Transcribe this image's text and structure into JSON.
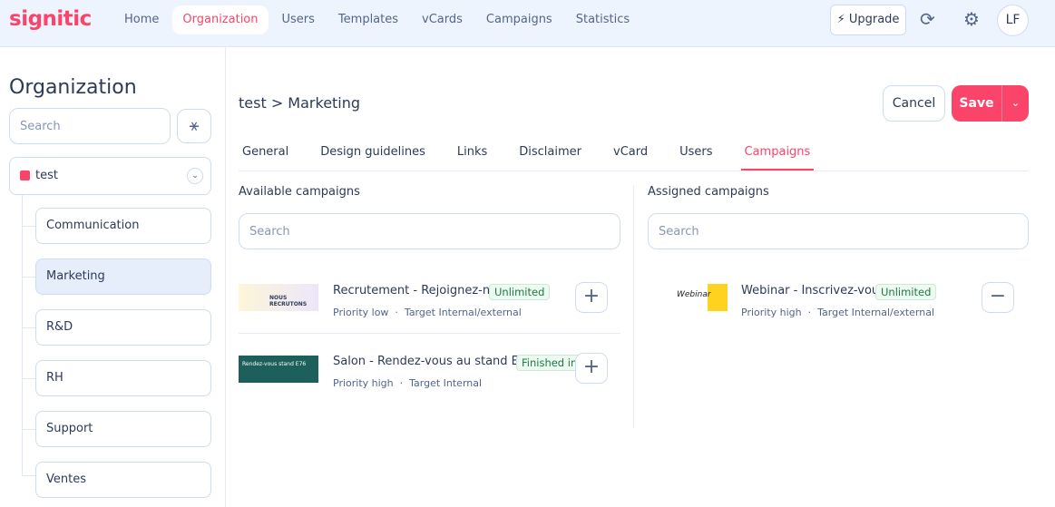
{
  "brand": {
    "logo": "signitic",
    "accent": "#fb4469"
  },
  "nav": {
    "items": [
      "Home",
      "Organization",
      "Users",
      "Templates",
      "vCards",
      "Campaigns",
      "Statistics"
    ],
    "active": 1,
    "upgrade": "Upgrade",
    "avatar": "LF"
  },
  "sidebar": {
    "title": "Organization",
    "search_placeholder": "Search",
    "root": "test",
    "children": [
      "Communication",
      "Marketing",
      "R&D",
      "RH",
      "Support",
      "Ventes"
    ],
    "selected": 1
  },
  "main": {
    "breadcrumb": "test > Marketing",
    "cancel": "Cancel",
    "save": "Save",
    "tabs": [
      "General",
      "Design guidelines",
      "Links",
      "Disclaimer",
      "vCard",
      "Users",
      "Campaigns"
    ],
    "active_tab": 6,
    "available": {
      "title": "Available campaigns",
      "search_placeholder": "Search",
      "items": [
        {
          "title": "Recrutement - Rejoignez-n...",
          "badge": "Unlimited",
          "priority": "Priority low",
          "target": "Target Internal/external",
          "thumb_text": "NOUS RECRUTONS"
        },
        {
          "title": "Salon - Rendez-vous au stand E76",
          "badge": "Finished in 3...",
          "priority": "Priority high",
          "target": "Target Internal",
          "thumb_text": "Rendez-vous stand E76"
        }
      ]
    },
    "assigned": {
      "title": "Assigned campaigns",
      "search_placeholder": "Search",
      "items": [
        {
          "title": "Webinar - Inscrivez-vous",
          "badge": "Unlimited",
          "priority": "Priority high",
          "target": "Target Internal/external",
          "thumb_text": "Webinar"
        }
      ]
    }
  }
}
